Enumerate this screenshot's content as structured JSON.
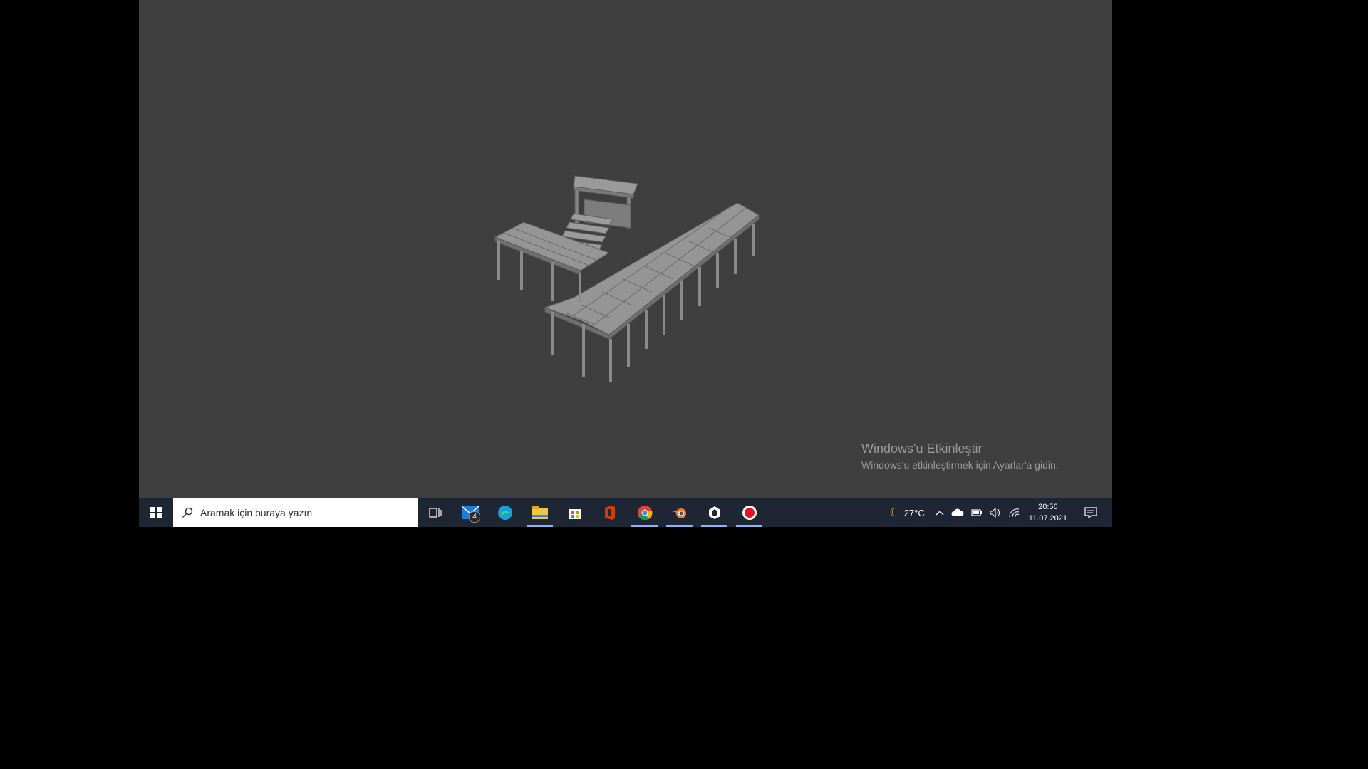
{
  "watermark": {
    "title": "Windows'u Etkinleştir",
    "subtitle": "Windows'u etkinleştirmek için Ayarlar'a gidin."
  },
  "taskbar": {
    "search_placeholder": "Aramak için buraya yazın",
    "apps": [
      {
        "name": "task-view-icon",
        "active": false
      },
      {
        "name": "mail-icon",
        "badge": "4",
        "active": false
      },
      {
        "name": "edge-icon",
        "active": false
      },
      {
        "name": "file-explorer-icon",
        "active": true
      },
      {
        "name": "store-icon",
        "active": false
      },
      {
        "name": "office-icon",
        "active": false
      },
      {
        "name": "chrome-icon",
        "active": true
      },
      {
        "name": "blender-icon",
        "active": true
      },
      {
        "name": "unity-icon",
        "active": true
      },
      {
        "name": "record-icon",
        "active": true
      }
    ],
    "tray": {
      "weather_icon": "moon-icon",
      "temperature": "27°C",
      "time": "20:56",
      "date": "11.07.2021"
    }
  },
  "colors": {
    "viewport_bg": "#3f3f3f",
    "taskbar_bg": "#1e2533",
    "model_gray": "#8c8c8c"
  }
}
